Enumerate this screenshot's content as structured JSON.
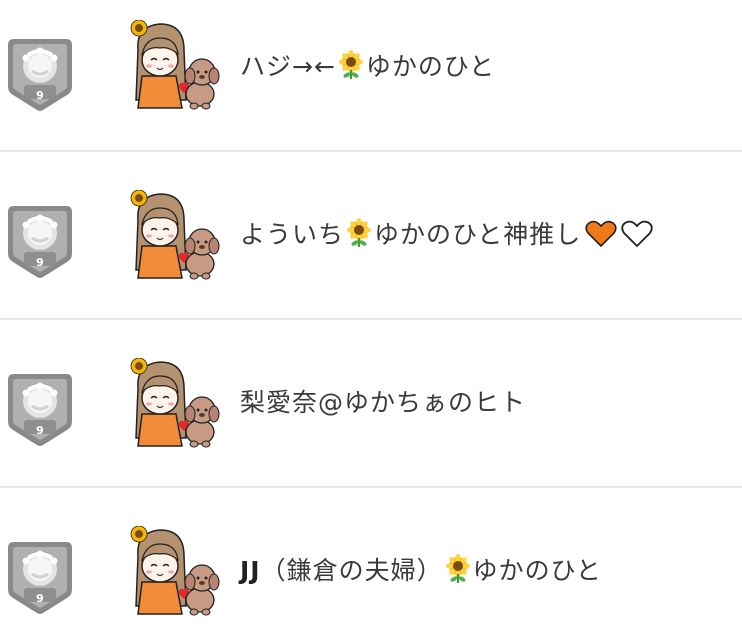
{
  "rows": [
    {
      "badge_level": "9",
      "name_before": "ハジ→←",
      "name_after": "ゆかのひと",
      "icons": [
        "medal-badge-icon",
        "avatar-girl-with-dog",
        "sunflower-icon"
      ]
    },
    {
      "badge_level": "9",
      "name_before": "よういち",
      "name_after": "ゆかのひと神推し",
      "icons": [
        "medal-badge-icon",
        "avatar-girl-with-dog",
        "sunflower-icon",
        "orange-heart-icon",
        "white-heart-icon"
      ]
    },
    {
      "badge_level": "9",
      "name_before": "梨愛奈@ゆかちぁのヒト",
      "icons": [
        "medal-badge-icon",
        "avatar-girl-with-dog"
      ]
    },
    {
      "badge_level": "9",
      "name_bold": "JJ",
      "name_before": "（鎌倉の夫婦）",
      "name_after": "ゆかのひと",
      "icons": [
        "medal-badge-icon",
        "avatar-girl-with-dog",
        "sunflower-icon"
      ]
    }
  ],
  "colors": {
    "badge_gray": "#8a8a8a",
    "badge_light": "#c9c9c9",
    "divider": "#e6e6e6",
    "sunflower_petal": "#f5b800",
    "sunflower_center": "#7a4a14",
    "orange_heart": "#f07a1a",
    "avatar_dress": "#f28c38",
    "avatar_hair": "#b5926f"
  }
}
